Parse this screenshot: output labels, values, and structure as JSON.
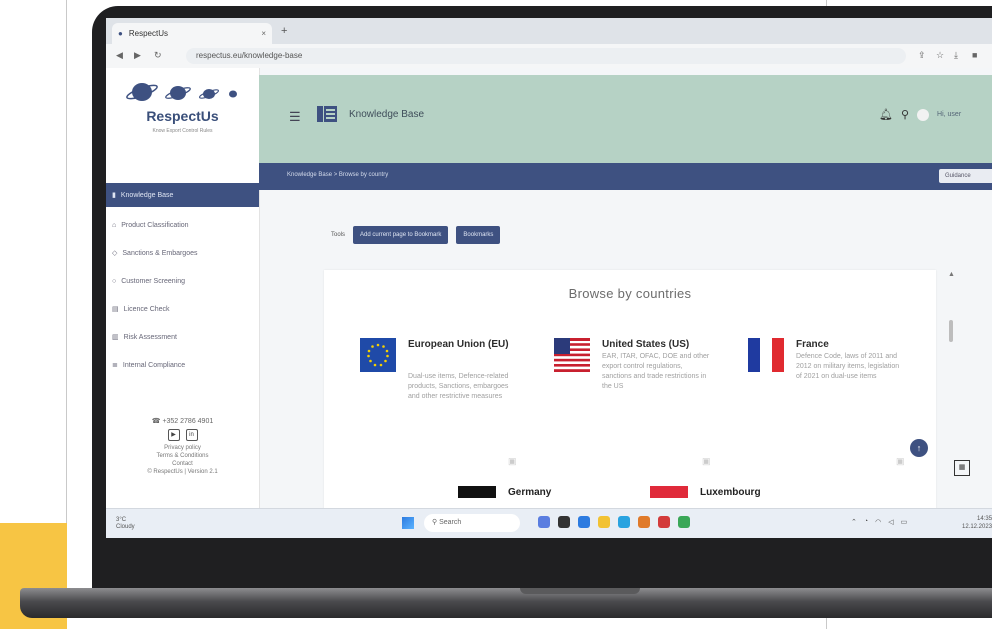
{
  "browser": {
    "tab_title": "RespectUs",
    "tab_close": "×",
    "new_tab": "+",
    "url": "respectus.eu/knowledge-base"
  },
  "sidebar": {
    "brand": "RespectUs",
    "tagline": "Know Export Control Rules",
    "items": [
      {
        "label": "Knowledge Base",
        "icon": "book-icon",
        "active": true
      },
      {
        "label": "Product Classification",
        "icon": "tag-icon",
        "active": false
      },
      {
        "label": "Sanctions & Embargoes",
        "icon": "shield-icon",
        "active": false
      },
      {
        "label": "Customer Screening",
        "icon": "search-icon",
        "active": false
      },
      {
        "label": "Licence Check",
        "icon": "document-icon",
        "active": false
      },
      {
        "label": "Risk Assessment",
        "icon": "chart-icon",
        "active": false
      },
      {
        "label": "Internal Compliance",
        "icon": "list-icon",
        "active": false
      }
    ],
    "phone": "+352 2786 4901",
    "footer_lines": [
      "Privacy policy",
      "Terms & Conditions",
      "Contact",
      "© RespectUs | Version 2.1"
    ]
  },
  "header": {
    "title": "Knowledge Base",
    "username": "Hi, user"
  },
  "breadcrumb": {
    "text": "Knowledge Base > Browse by country",
    "right_button": "Guidance"
  },
  "toolbar": {
    "label": "Tools",
    "bookmark_button": "Add current page to Bookmark",
    "bookmarks_button": "Bookmarks"
  },
  "main": {
    "browse_title": "Browse by countries",
    "countries": [
      {
        "name": "European Union (EU)",
        "desc": "Dual-use items, Defence-related products, Sanctions, embargoes and other restrictive measures"
      },
      {
        "name": "United States (US)",
        "desc": "EAR, ITAR, OFAC, DOE and other export control regulations, sanctions and trade restrictions in the US"
      },
      {
        "name": "France",
        "desc": "Defence Code, laws of 2011 and 2012 on military items, legislation of 2021 on dual-use items"
      }
    ],
    "bottom_countries": [
      "Germany",
      "Luxembourg"
    ]
  },
  "taskbar": {
    "weather_temp": "3°C",
    "weather_text": "Cloudy",
    "search_placeholder": "Search",
    "time": "14:35",
    "date": "12.12.2023"
  },
  "colors": {
    "primary": "#3e5181",
    "header_bg": "#b6d2c5",
    "accent_yellow": "#f7c544"
  }
}
